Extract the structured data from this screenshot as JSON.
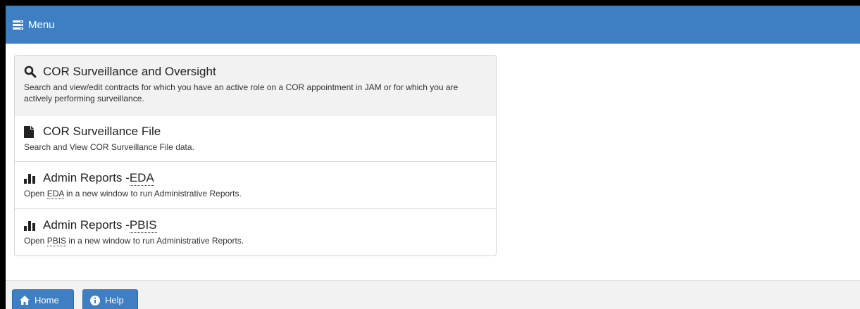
{
  "menu_bar": {
    "title": "Menu",
    "icon": "menu-list-icon"
  },
  "items": [
    {
      "icon": "search-icon",
      "title": "COR Surveillance and Oversight",
      "description": "Search and view/edit contracts for which you have an active role on a COR appointment in JAM or for which you are actively performing surveillance."
    },
    {
      "icon": "file-icon",
      "title": "COR Surveillance File",
      "description": "Search and View COR Surveillance File data."
    },
    {
      "icon": "bar-chart-icon",
      "title_prefix": "Admin Reports - ",
      "title_abbr": "EDA",
      "desc_prefix": "Open ",
      "desc_abbr": "EDA",
      "desc_suffix": " in a new window to run Administrative Reports."
    },
    {
      "icon": "bar-chart-icon",
      "title_prefix": "Admin Reports - ",
      "title_abbr": "PBIS",
      "desc_prefix": "Open ",
      "desc_abbr": "PBIS",
      "desc_suffix": " in a new window to run Administrative Reports."
    }
  ],
  "footer": {
    "home_label": "Home",
    "home_icon": "home-icon",
    "help_label": "Help",
    "help_icon": "info-circle-icon"
  },
  "colors": {
    "accent": "#3e7fc3",
    "active_item_bg": "#f2f2f2",
    "footer_bg": "#f2f2f2"
  }
}
